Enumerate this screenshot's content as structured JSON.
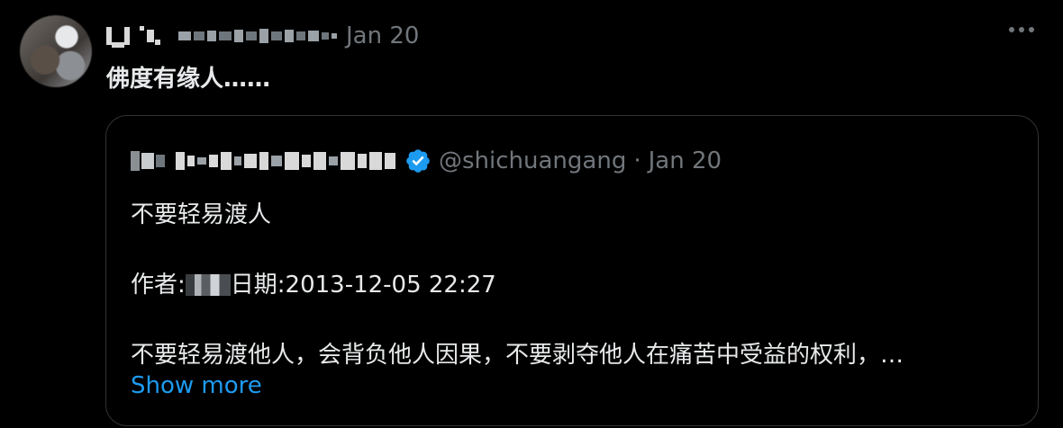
{
  "tweet": {
    "time": "Jan 20",
    "dot": "·",
    "text": "佛度有缘人……",
    "more_icon": "more-horizontal-icon"
  },
  "quote": {
    "handle": "@shichuangang",
    "dot": "·",
    "time": "Jan 20",
    "verified_icon": "verified-badge-icon",
    "lines": {
      "title": "不要轻易渡人",
      "author_prefix": "作者:",
      "date_text": "日期:2013-12-05 22:27",
      "body": "不要轻易渡他人，会背负他人因果，不要剥夺他人在痛苦中受益的权利，…"
    },
    "show_more": "Show more"
  },
  "colors": {
    "background": "#000000",
    "text": "#e7e9ea",
    "muted": "#71767b",
    "link": "#1d9bf0",
    "border": "#2f3336"
  }
}
